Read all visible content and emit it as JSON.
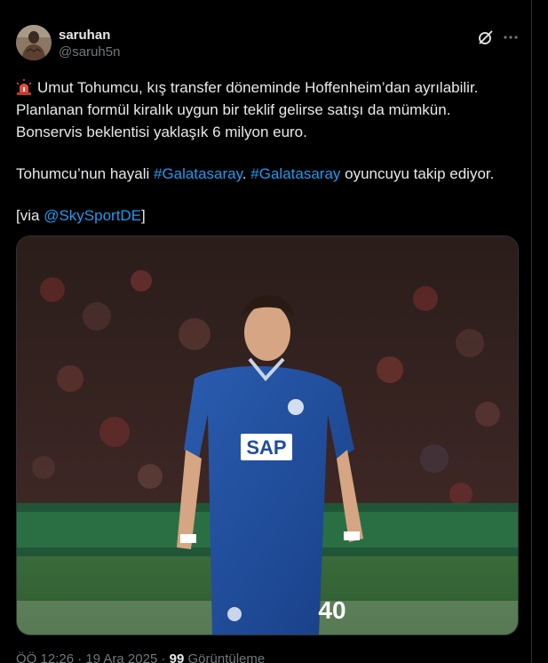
{
  "author": {
    "display_name": "saruhan",
    "handle": "@saruh5n"
  },
  "tweet": {
    "line1": "Umut Tohumcu, kış transfer döneminde Hoffenheim’dan ayrılabilir.",
    "line2": "Planlanan formül kiralık uygun bir teklif gelirse satışı da mümkün.",
    "line3": "Bonservis beklentisi yaklaşık 6 milyon euro.",
    "line4_prefix": "Tohumcu’nun hayali ",
    "hashtag1": "#Galatasaray",
    "line4_mid": ". ",
    "hashtag2": "#Galatasaray",
    "line4_suffix": " oyuncuyu takip ediyor.",
    "via_prefix": "[via ",
    "via_mention": "@SkySportDE",
    "via_suffix": "]"
  },
  "media": {
    "jersey_sponsor": "SAP",
    "jersey_number": "40"
  },
  "meta": {
    "time": "ÖÖ 12:26",
    "separator": "·",
    "date": "19 Ara 2025",
    "views_count": "99",
    "views_label": "Görüntüleme"
  },
  "icons": {
    "siren": "police-siren-icon",
    "grok": "grok-icon",
    "more": "more-horizontal-icon"
  },
  "colors": {
    "background": "#000000",
    "text": "#e7e9ea",
    "muted": "#71767b",
    "link": "#1d9bf0",
    "jersey": "#1f4d9e"
  }
}
